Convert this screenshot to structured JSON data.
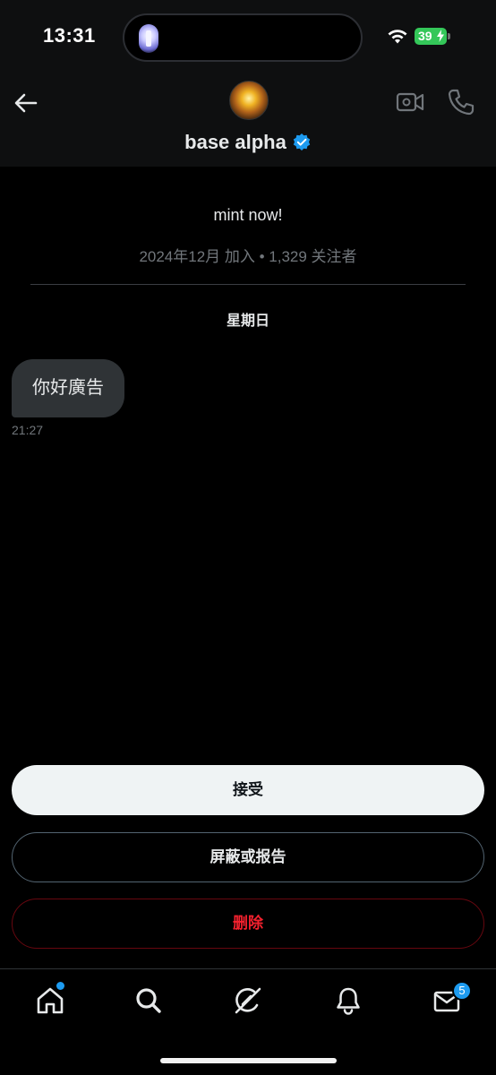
{
  "status_bar": {
    "time": "13:31",
    "battery": "39",
    "icons": [
      "wifi-icon",
      "battery-icon",
      "flashlight-icon"
    ]
  },
  "header": {
    "name": "base alpha",
    "icons": [
      "back-arrow-icon",
      "avatar",
      "verified-badge-icon",
      "video-call-icon",
      "phone-icon"
    ]
  },
  "profile": {
    "bio": "mint now!",
    "meta": "2024年12月 加入 • 1,329 关注者"
  },
  "conversation": {
    "day_label": "星期日",
    "messages": [
      {
        "text": "你好廣告",
        "time": "21:27"
      }
    ]
  },
  "actions": {
    "accept": "接受",
    "block_or_report": "屏蔽或报告",
    "delete": "删除"
  },
  "bottom_nav": {
    "items": [
      "home-icon",
      "search-icon",
      "grok-icon",
      "notifications-icon",
      "messages-icon"
    ],
    "messages_badge": "5"
  },
  "colors": {
    "accent": "#1d9bf0",
    "danger": "#f4212e",
    "battery": "#34c759"
  }
}
